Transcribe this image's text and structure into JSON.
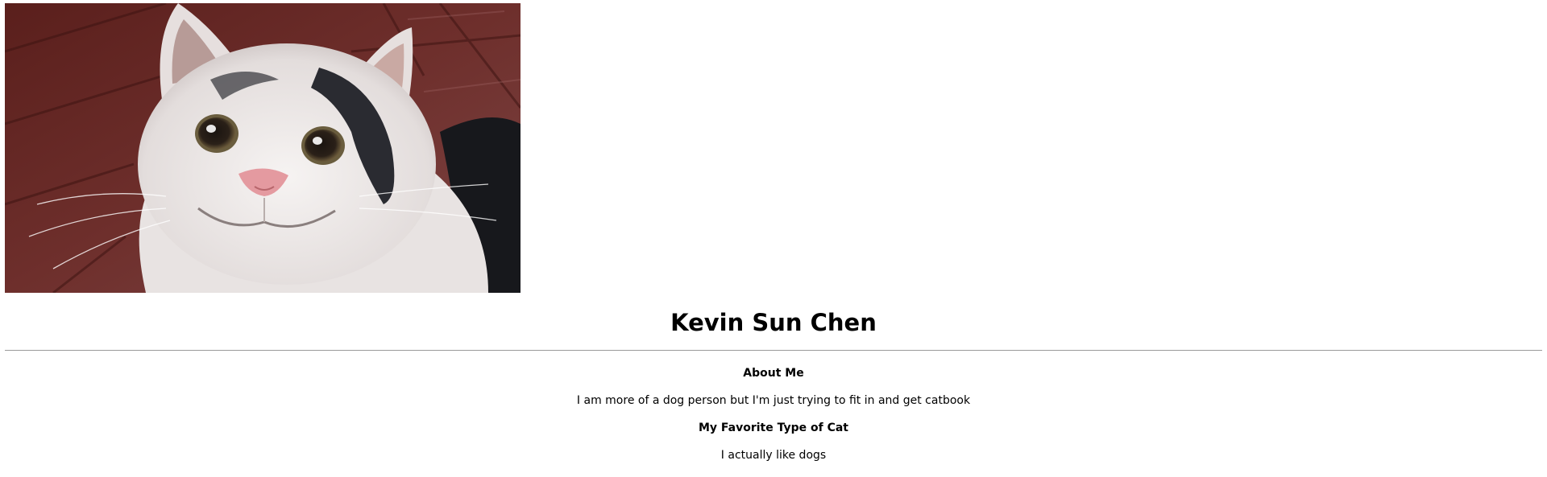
{
  "profile": {
    "image_alt": "",
    "name": "Kevin Sun Chen"
  },
  "about": {
    "title": "About Me",
    "text": "I am more of a dog person but I'm just trying to fit in and get catbook"
  },
  "favorite_cat": {
    "title": "My Favorite Type of Cat",
    "text": "I actually like dogs"
  },
  "colors": {
    "background": "#ffffff",
    "text": "#000000",
    "divider": "#9a9a9a"
  }
}
